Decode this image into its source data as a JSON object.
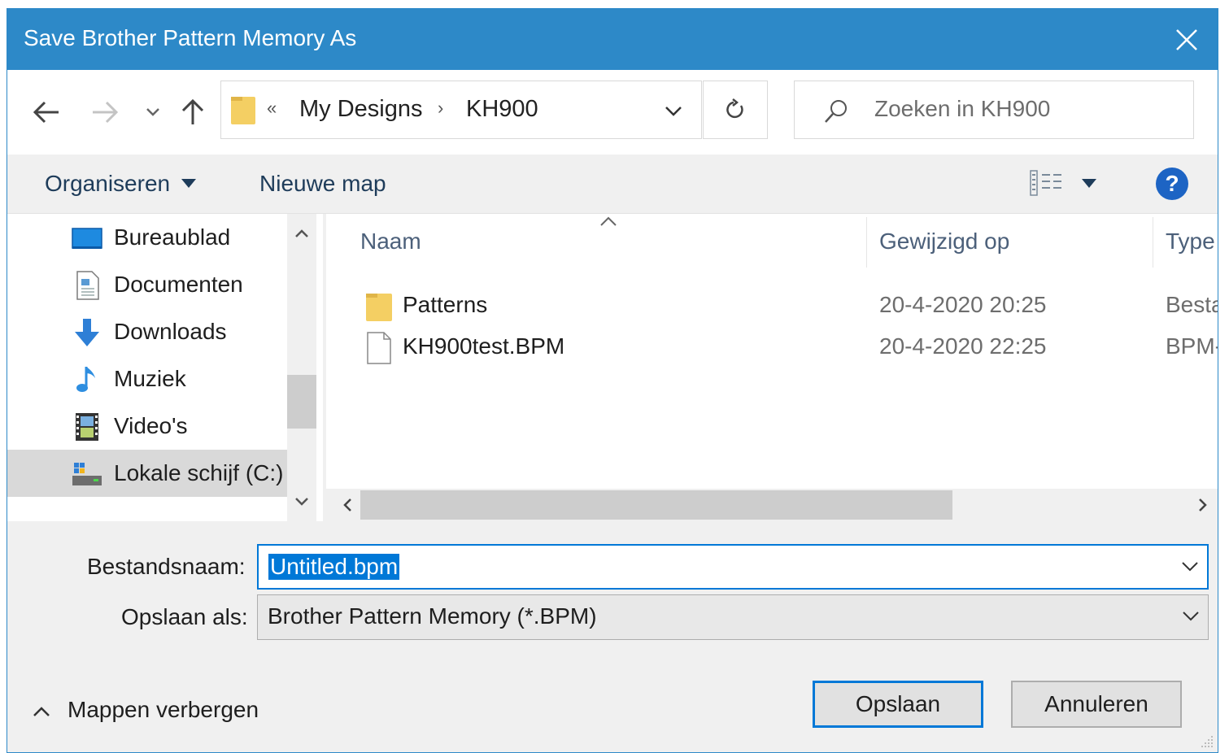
{
  "window": {
    "title": "Save Brother Pattern Memory As"
  },
  "address": {
    "overflow": "«",
    "crumbs": [
      "My Designs",
      "KH900"
    ],
    "separator": "›"
  },
  "search": {
    "placeholder": "Zoeken in KH900"
  },
  "commands": {
    "organize": "Organiseren",
    "new_folder": "Nieuwe map",
    "help": "?"
  },
  "nav_pane": {
    "items": [
      {
        "label": "Bureaublad",
        "icon": "desktop-icon"
      },
      {
        "label": "Documenten",
        "icon": "documents-icon"
      },
      {
        "label": "Downloads",
        "icon": "download-arrow-icon"
      },
      {
        "label": "Muziek",
        "icon": "music-note-icon"
      },
      {
        "label": "Video's",
        "icon": "film-icon"
      },
      {
        "label": "Lokale schijf (C:)",
        "icon": "local-disk-icon",
        "selected": true
      }
    ]
  },
  "file_list": {
    "columns": {
      "name": "Naam",
      "modified": "Gewijzigd op",
      "type": "Type"
    },
    "rows": [
      {
        "name": "Patterns",
        "modified": "20-4-2020 20:25",
        "type": "Besta",
        "icon": "folder-icon"
      },
      {
        "name": "KH900test.BPM",
        "modified": "20-4-2020 22:25",
        "type": "BPM-",
        "icon": "file-icon"
      }
    ]
  },
  "form": {
    "filename_label": "Bestandsnaam:",
    "filename_value": "Untitled.bpm",
    "savetype_label": "Opslaan als:",
    "savetype_value": "Brother Pattern Memory (*.BPM)"
  },
  "footer": {
    "hide_folders": "Mappen verbergen",
    "save": "Opslaan",
    "cancel": "Annuleren"
  },
  "colors": {
    "accent": "#2d89c8",
    "selection": "#0078d7",
    "help": "#1d64c4"
  }
}
